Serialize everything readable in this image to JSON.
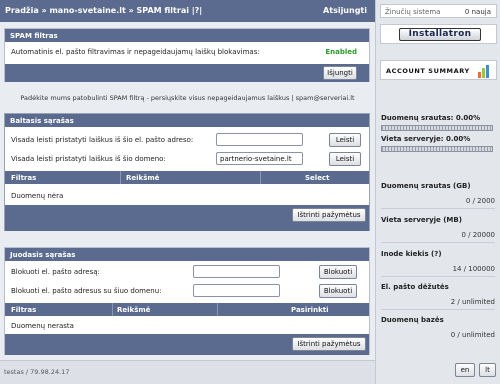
{
  "header": {
    "breadcrumb": "Pradžia » mano-svetaine.lt » SPAM filtrai |?|",
    "logout": "Atsijungti"
  },
  "spam_filter": {
    "title": "SPAM filtras",
    "auto_label": "Automatinis el. pašto filtravimas ir nepageidaujamų laiškų blokavimas:",
    "status": "Enabled",
    "status_color": "#2e9a2e",
    "disable_button": "Išjungti"
  },
  "notice": "Padėkite mums patobulinti SPAM filtrą - persiųskite visus nepageidaujamus laiškus | spam@serveriai.lt",
  "whitelist": {
    "title": "Baltasis sąrašas",
    "email_label": "Visada leisti pristatyti laiškus iš šio el. pašto adreso:",
    "email_value": "",
    "email_button": "Leisti",
    "domain_label": "Visada leisti pristatyti laiškus iš šio domeno:",
    "domain_value": "partnerio-svetaine.lt",
    "domain_button": "Leisti",
    "columns": [
      "Filtras",
      "Reikšmė",
      "Select"
    ],
    "empty": "Duomenų nėra",
    "delete_button": "Ištrinti pažymėtus"
  },
  "blacklist": {
    "title": "Juodasis sąrašas",
    "email_label": "Blokuoti el. pašto adresą:",
    "email_value": "",
    "email_button": "Blokuoti",
    "domain_label": "Blokuoti el. pašto adresus su šiuo domenu:",
    "domain_value": "",
    "domain_button": "Blokuoti",
    "columns": [
      "Filtras",
      "Reikšmė",
      "Pasirinkti"
    ],
    "empty": "Duomenų nerasta",
    "delete_button": "Ištrinti pažymėtus"
  },
  "footer": {
    "user_ip": "testas / 79.98.24.17",
    "lang_en": "en",
    "lang_lt": "lt"
  },
  "sidebar": {
    "system_notices_label": "Žinučių sistema",
    "system_notices_value": "0 nauja",
    "installatron": "Installatron",
    "account_summary": "ACCOUNT SUMMARY",
    "bandwidth_label": "Duomenų srautas: 0.00%",
    "bandwidth_percent": 0,
    "disk_label": "Vieta serveryje: 0.00%",
    "disk_percent": 0,
    "stats": [
      {
        "label": "Duomenų srautas (GB)",
        "value": "0 / 2000"
      },
      {
        "label": "Vieta serveryje (MB)",
        "value": "0 / 20000"
      },
      {
        "label": "Inode kiekis (?)",
        "value": "14 / 100000"
      },
      {
        "label": "El. pašto dėžutės",
        "value": "2 / unlimited"
      },
      {
        "label": "Duomenų bazės",
        "value": "0 / unlimited"
      }
    ]
  }
}
